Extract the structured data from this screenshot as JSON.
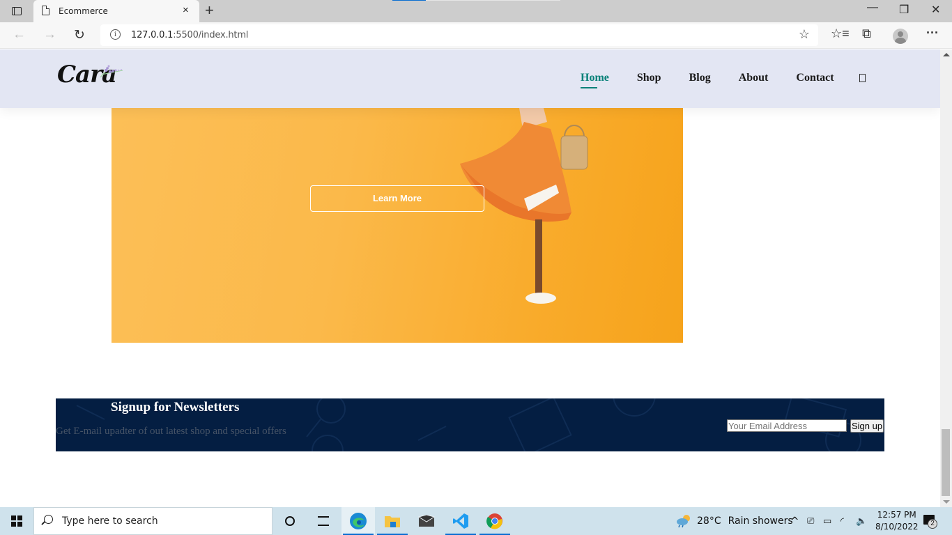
{
  "browser": {
    "tab": {
      "title": "Ecommerce",
      "close_label": "×"
    },
    "new_tab_label": "+",
    "window_controls": {
      "minimize": "—",
      "restore": "❐",
      "close": "✕"
    },
    "nav": {
      "back": "←",
      "forward": "→",
      "reload": "↻"
    },
    "address": {
      "host": "127.0.0.1",
      "rest": ":5500/index.html"
    },
    "icons": {
      "add_favorite": "☆",
      "favorites": "☆≡",
      "collections": "⧉",
      "more": "···"
    }
  },
  "site": {
    "logo_text": "Cara",
    "nav": [
      {
        "label": "Home",
        "active": true
      },
      {
        "label": "Shop",
        "active": false
      },
      {
        "label": "Blog",
        "active": false
      },
      {
        "label": "About",
        "active": false
      },
      {
        "label": "Contact",
        "active": false
      }
    ],
    "accent_color": "#088178",
    "banner": {
      "button_label": "Learn More",
      "bg_color": "#fbb94a"
    },
    "newsletter": {
      "title": "Signup for Newsletters",
      "text": "Get E-mail upadter of out latest shop and special offers",
      "email_placeholder": "Your Email Address",
      "email_value": "",
      "button_label": "Sign up",
      "bg_color": "#041e42"
    }
  },
  "taskbar": {
    "search_placeholder": "Type here to search",
    "apps": [
      "cortana",
      "task-view",
      "edge",
      "file-explorer",
      "mail",
      "vscode",
      "chrome"
    ],
    "weather": {
      "temp": "28°C",
      "condition": "Rain showers"
    },
    "tray_chevron": "^",
    "time": "12:57 PM",
    "date": "8/10/2022",
    "notification_count": "2"
  }
}
